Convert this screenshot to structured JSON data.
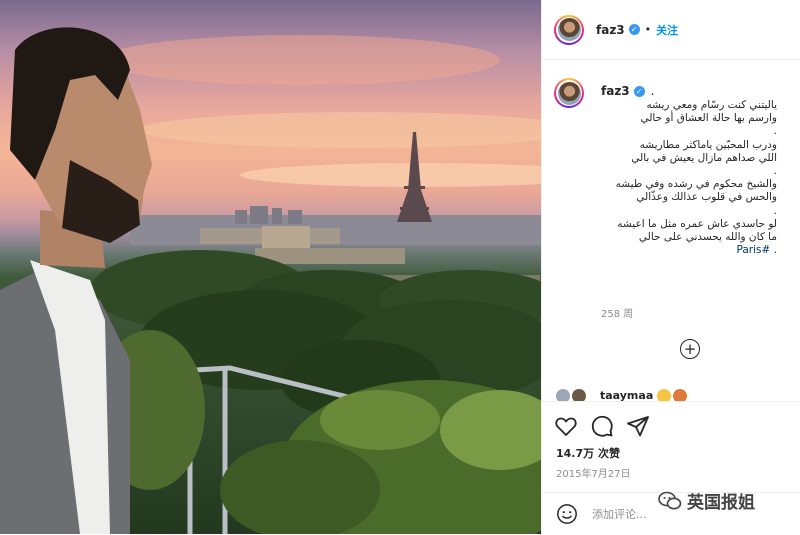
{
  "post": {
    "username": "faz3",
    "follow_label": "关注",
    "separator": "•",
    "caption_username": "faz3",
    "caption_trail": ".",
    "caption_text": "ياليتني كنت رسّام ومعي ريشه\nوارسم بها حالة العشاق أو حالي\n.\nودرب المحبّين ياماكثر مطاريشه\nاللي صداهم مازال يعيش في بالي\n.\nوالشيخ محكوم في رشده وفي طيشه\nوالحس في قلوب عذالك وعذّالي\n.\nلو حاسدي عاش عمره مثل ما اعيشه\nما كان والله يحسدني على حالي\n. ",
    "hashtag": "#Paris",
    "time_ago": "258 周",
    "likes": "14.7万 次赞",
    "date": "2015年7月27日",
    "comment_placeholder": "添加评论...",
    "liker_name": "taaymaa",
    "watermark": "英国报姐"
  },
  "icons": {
    "verified": "verified-badge-icon",
    "like": "heart-icon",
    "comment": "comment-icon",
    "share": "paper-plane-icon",
    "more_comments": "plus-circle-icon",
    "emoji": "emoji-icon",
    "watermark": "wechat-icon"
  },
  "colors": {
    "link_blue": "#0095f6",
    "verified_blue": "#3897f0",
    "muted_gray": "#8e8e8e",
    "text": "#262626"
  }
}
